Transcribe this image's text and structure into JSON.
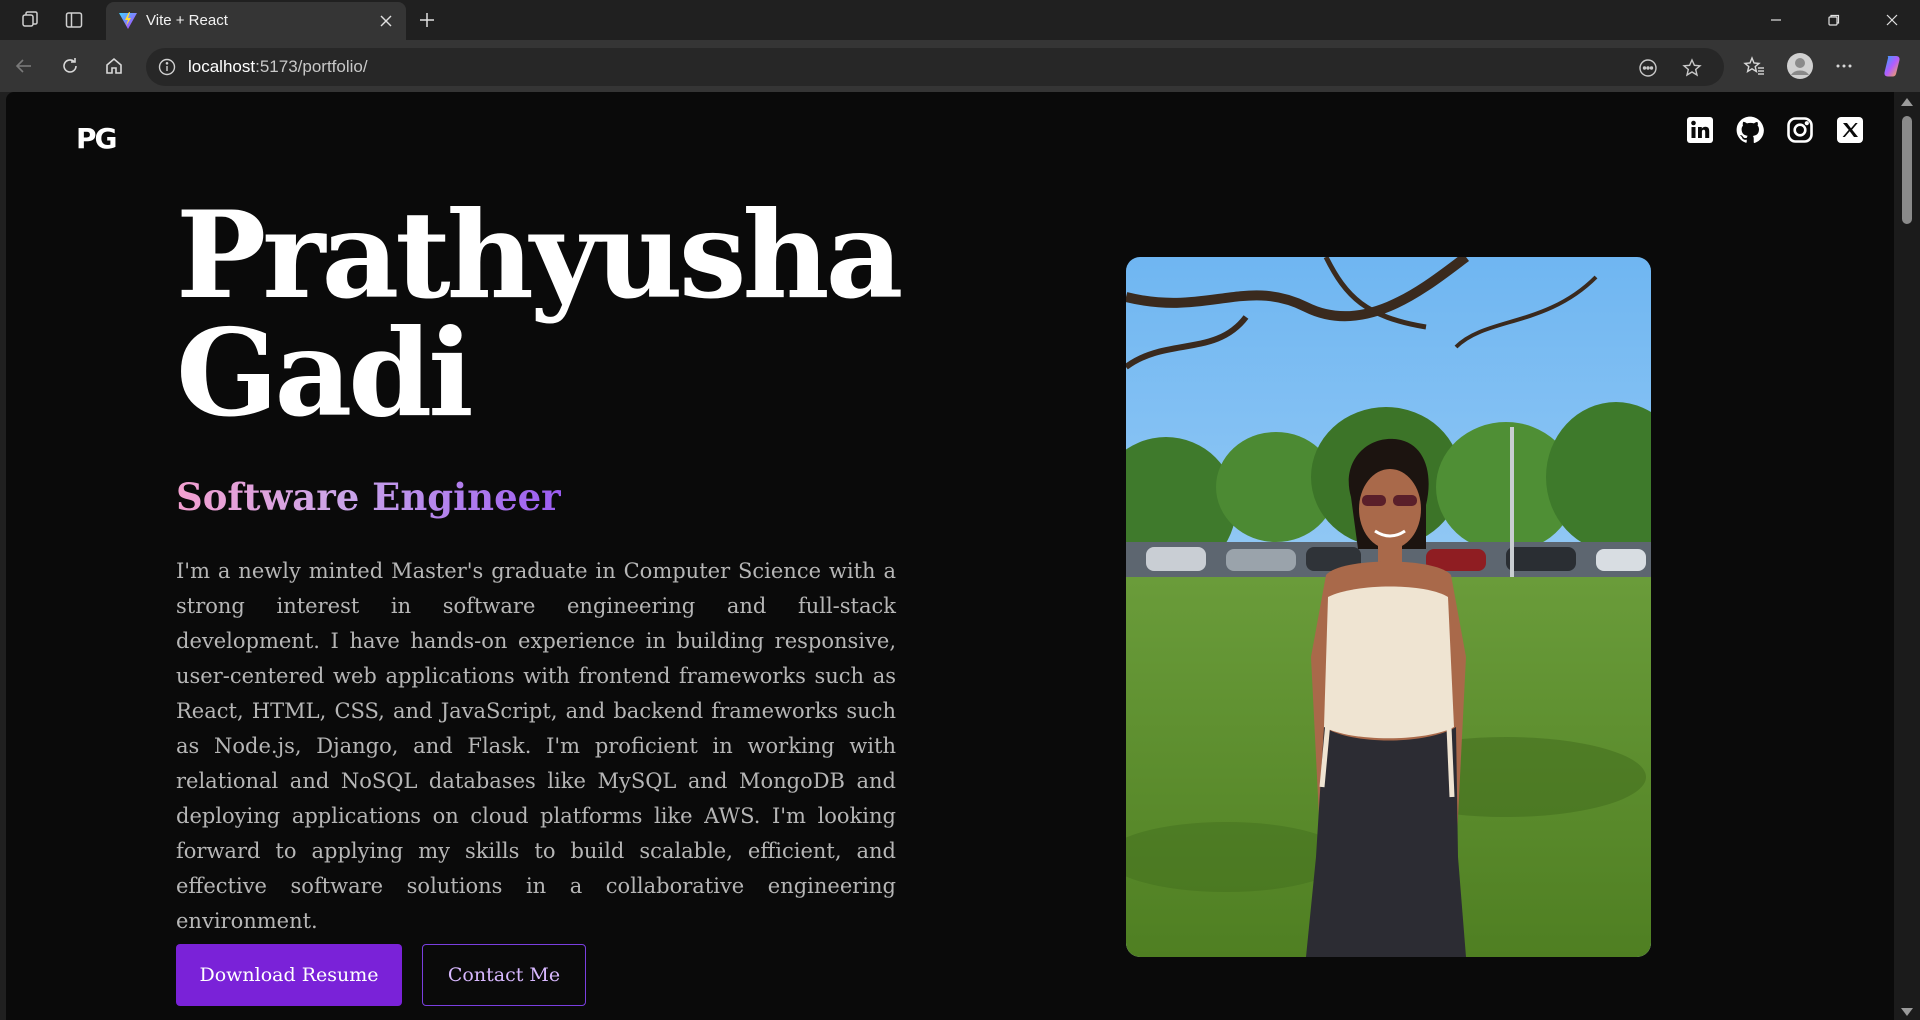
{
  "browser": {
    "tab_title": "Vite + React",
    "url_host": "localhost",
    "url_rest": ":5173/portfolio/"
  },
  "page": {
    "logo": "PG",
    "socials": [
      "linkedin-icon",
      "github-icon",
      "instagram-icon",
      "x-icon"
    ],
    "name_line1": "Prathyusha",
    "name_line2": "Gadi",
    "role": "Software Engineer",
    "bio": "I'm a newly minted Master's graduate in Computer Science with a strong interest in software engineering and full-stack development. I have hands-on experience in building responsive, user-centered web applications with frontend frameworks such as React, HTML, CSS, and JavaScript, and backend frameworks such as Node.js, Django, and Flask. I'm proficient in working with relational and NoSQL databases like MySQL and MongoDB and deploying applications on cloud platforms like AWS. I'm looking forward to applying my skills to build scalable, efficient, and effective software solutions in a collaborative engineering environment.",
    "primary_button": "Download Resume",
    "secondary_button": "Contact Me"
  },
  "colors": {
    "accent": "#7a22d8",
    "background": "#0a0a0a",
    "role_gradient_start": "#f3a0d0",
    "role_gradient_end": "#9b5cf0"
  }
}
